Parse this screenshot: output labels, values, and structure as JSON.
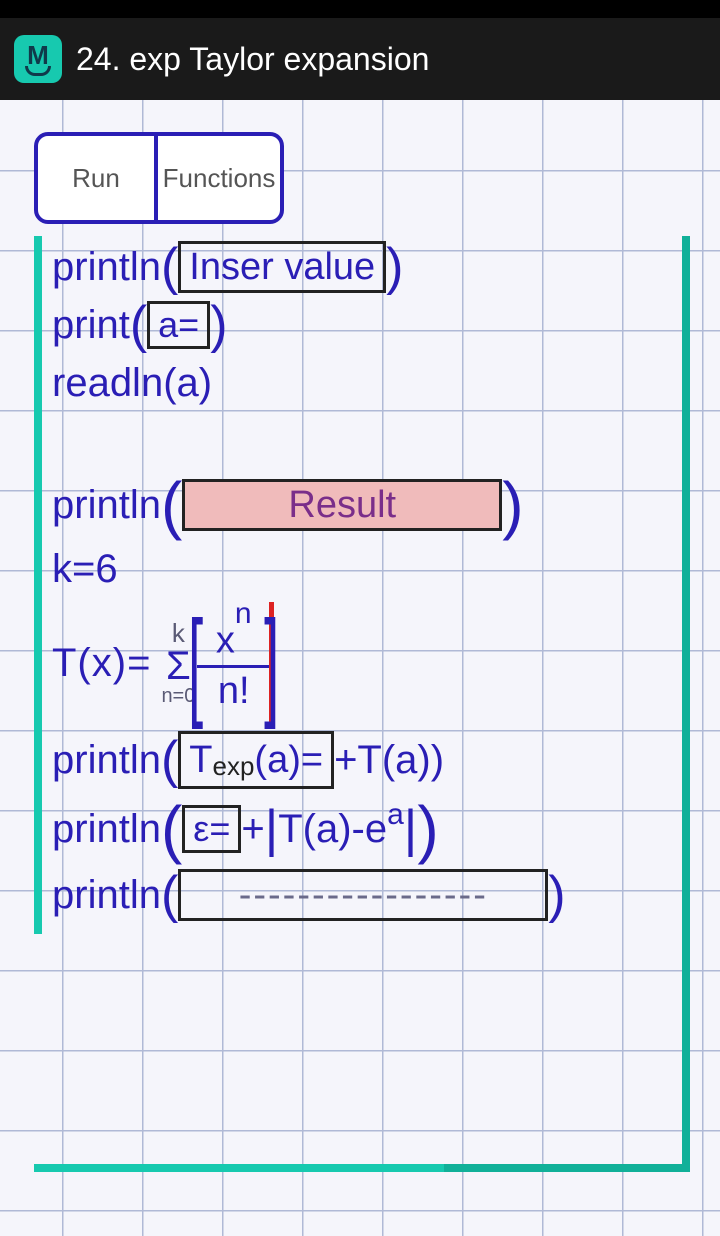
{
  "header": {
    "title": "24. exp Taylor expansion"
  },
  "buttons": {
    "run": "Run",
    "functions": "Functions"
  },
  "code": {
    "l1": {
      "fn": "println",
      "box": "Inser value"
    },
    "l2": {
      "fn": "print",
      "box": "a="
    },
    "l3": {
      "fn": "readln(a)"
    },
    "l4": {
      "fn": "println",
      "box": "Result"
    },
    "l5": {
      "text": "k=6"
    },
    "sum": {
      "lhs": "T(x)=",
      "upper": "k",
      "lower": "n=0",
      "num_base": "x",
      "num_exp": "n",
      "den": "n!"
    },
    "l7": {
      "fn": "println",
      "box_base": "T",
      "box_sub": "exp",
      "box_tail": "(a)=",
      "tail": "+T(a))"
    },
    "l8": {
      "fn": "println",
      "box": "ε=",
      "mid": "+",
      "abs_inner_left": "T(a)-e",
      "abs_exp": "a"
    },
    "l9": {
      "fn": "println",
      "box": "-----------------"
    }
  }
}
